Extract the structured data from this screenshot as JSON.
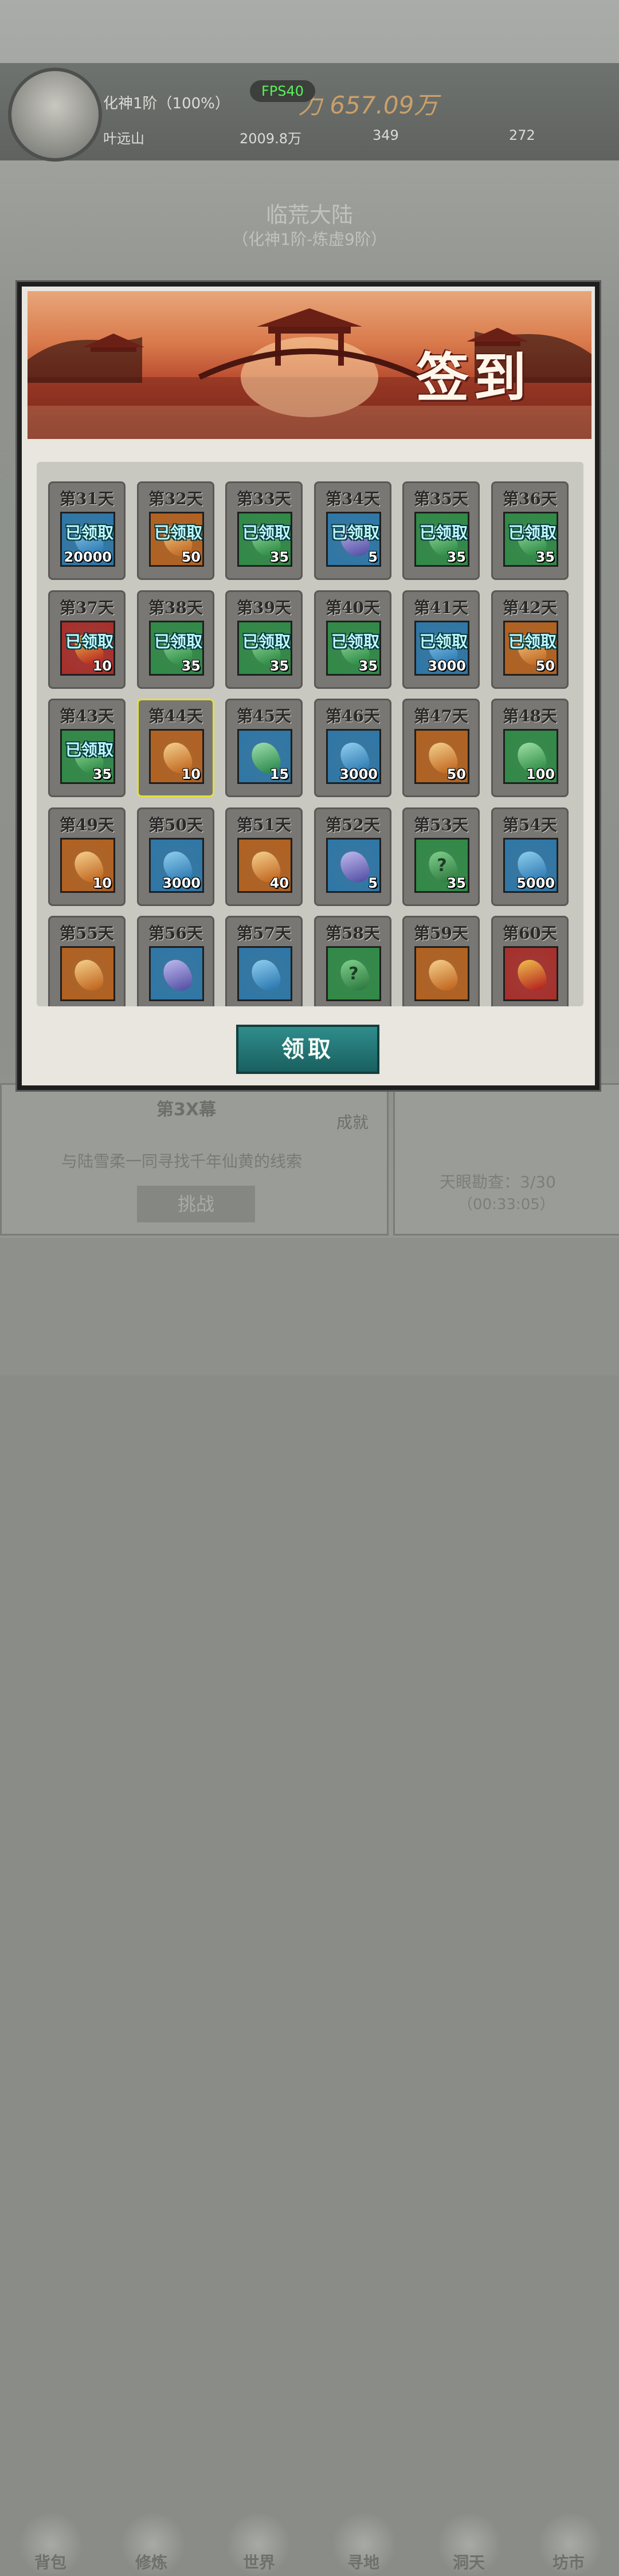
{
  "hud": {
    "fps": "FPS40",
    "realm": "化神1阶（100%）",
    "player_name": "叶远山",
    "power": "力 657.09万",
    "spirit_stones": "2009.8万",
    "gold": "349",
    "elixir": "272"
  },
  "map": {
    "title": "临荒大陆",
    "subtitle": "（化神1阶-炼虚9阶）"
  },
  "background_panel": {
    "quest_title": "第3X幕",
    "quest_desc": "与陆雪柔一同寻找千年仙黄的线索",
    "challenge_button": "挑战",
    "achievement_label": "成就",
    "tianyan_status": "天眼勘查：3/30",
    "tianyan_timer": "（00:33:05）"
  },
  "bottom_nav": [
    {
      "label": "背包",
      "icon": "bag-icon"
    },
    {
      "label": "修炼",
      "icon": "cultivation-icon"
    },
    {
      "label": "世界",
      "icon": "world-icon"
    },
    {
      "label": "寻地",
      "icon": "explore-icon"
    },
    {
      "label": "洞天",
      "icon": "cave-icon"
    },
    {
      "label": "坊市",
      "icon": "market-icon"
    }
  ],
  "signin": {
    "title": "签到",
    "claim_button": "领取",
    "claimed_label": "已领取",
    "days": [
      {
        "day": "第31天",
        "qty": "20000",
        "bg": "#2d77a8",
        "item": "blue-crystal-icon",
        "claimed": true
      },
      {
        "day": "第32天",
        "qty": "50",
        "bg": "#b3611f",
        "item": "orange-stone-icon",
        "claimed": true
      },
      {
        "day": "第33天",
        "qty": "35",
        "bg": "#2f8a46",
        "item": "green-jade-icon",
        "claimed": true
      },
      {
        "day": "第34天",
        "qty": "5",
        "bg": "#2d77a8",
        "item": "purple-scroll-icon",
        "claimed": true
      },
      {
        "day": "第35天",
        "qty": "35",
        "bg": "#2f8a46",
        "item": "green-jade-icon",
        "claimed": true
      },
      {
        "day": "第36天",
        "qty": "35",
        "bg": "#2f8a46",
        "item": "green-jade-icon",
        "claimed": true
      },
      {
        "day": "第37天",
        "qty": "10",
        "bg": "#a82e2a",
        "item": "red-artifact-icon",
        "claimed": true
      },
      {
        "day": "第38天",
        "qty": "35",
        "bg": "#2f8a46",
        "item": "green-jade-icon",
        "claimed": true
      },
      {
        "day": "第39天",
        "qty": "35",
        "bg": "#2f8a46",
        "item": "green-jade-icon",
        "claimed": true
      },
      {
        "day": "第40天",
        "qty": "35",
        "bg": "#2f8a46",
        "item": "green-jade-icon",
        "claimed": true
      },
      {
        "day": "第41天",
        "qty": "3000",
        "bg": "#2d77a8",
        "item": "blue-crystal-icon",
        "claimed": true
      },
      {
        "day": "第42天",
        "qty": "50",
        "bg": "#b3611f",
        "item": "orange-stone-icon",
        "claimed": true
      },
      {
        "day": "第43天",
        "qty": "35",
        "bg": "#2f8a46",
        "item": "green-jade-icon",
        "claimed": true
      },
      {
        "day": "第44天",
        "qty": "10",
        "bg": "#b3611f",
        "item": "orange-scroll-icon",
        "claimed": false,
        "selected": true
      },
      {
        "day": "第45天",
        "qty": "15",
        "bg": "#2d77a8",
        "item": "green-beast-icon",
        "claimed": false
      },
      {
        "day": "第46天",
        "qty": "3000",
        "bg": "#2d77a8",
        "item": "blue-crystal-icon",
        "claimed": false
      },
      {
        "day": "第47天",
        "qty": "50",
        "bg": "#b3611f",
        "item": "orange-stone-icon",
        "claimed": false
      },
      {
        "day": "第48天",
        "qty": "100",
        "bg": "#2f8a46",
        "item": "green-jade-icon",
        "claimed": false
      },
      {
        "day": "第49天",
        "qty": "10",
        "bg": "#b3611f",
        "item": "orange-scroll-icon",
        "claimed": false
      },
      {
        "day": "第50天",
        "qty": "3000",
        "bg": "#2d77a8",
        "item": "blue-crystal-icon",
        "claimed": false
      },
      {
        "day": "第51天",
        "qty": "40",
        "bg": "#b3611f",
        "item": "orange-stone-icon",
        "claimed": false
      },
      {
        "day": "第52天",
        "qty": "5",
        "bg": "#2d77a8",
        "item": "purple-scroll-icon",
        "claimed": false
      },
      {
        "day": "第53天",
        "qty": "35",
        "bg": "#2f8a46",
        "item": "mystery-jade-icon",
        "claimed": false
      },
      {
        "day": "第54天",
        "qty": "5000",
        "bg": "#2d77a8",
        "item": "blue-crystal-icon",
        "claimed": false
      },
      {
        "day": "第55天",
        "qty": "",
        "bg": "#b3611f",
        "item": "orange-stone-icon",
        "claimed": false
      },
      {
        "day": "第56天",
        "qty": "",
        "bg": "#2d77a8",
        "item": "purple-scroll-icon",
        "claimed": false
      },
      {
        "day": "第57天",
        "qty": "",
        "bg": "#2d77a8",
        "item": "blue-crystal-icon",
        "claimed": false
      },
      {
        "day": "第58天",
        "qty": "",
        "bg": "#2f8a46",
        "item": "mystery-jade-icon",
        "claimed": false
      },
      {
        "day": "第59天",
        "qty": "",
        "bg": "#b3611f",
        "item": "orange-stone-icon",
        "claimed": false
      },
      {
        "day": "第60天",
        "qty": "",
        "bg": "#a82e2a",
        "item": "red-artifact-icon",
        "claimed": false
      }
    ]
  }
}
